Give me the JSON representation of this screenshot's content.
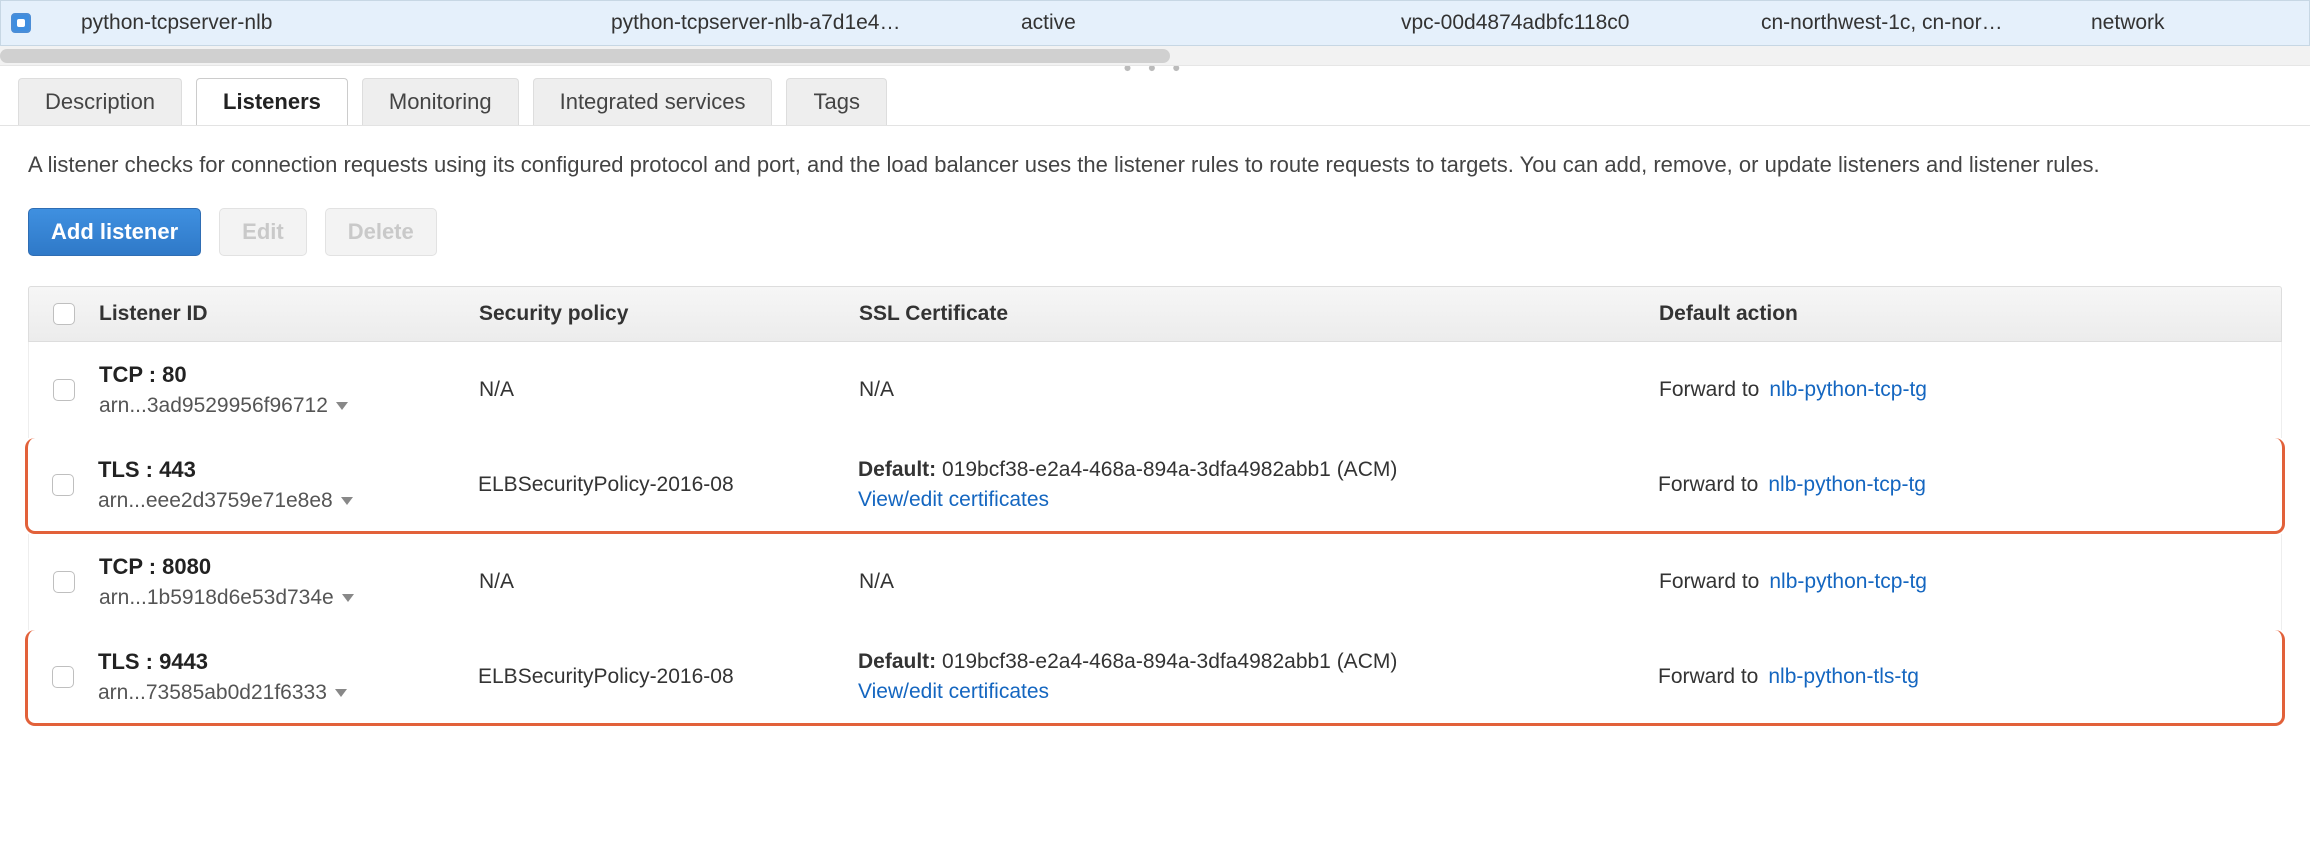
{
  "loadBalancer": {
    "name": "python-tcpserver-nlb",
    "dns": "python-tcpserver-nlb-a7d1e4…",
    "state": "active",
    "vpc": "vpc-00d4874adbfc118c0",
    "az": "cn-northwest-1c, cn-nor…",
    "type": "network"
  },
  "tabs": {
    "description": "Description",
    "listeners": "Listeners",
    "monitoring": "Monitoring",
    "integrated": "Integrated services",
    "tags": "Tags"
  },
  "listenersTab": {
    "description": "A listener checks for connection requests using its configured protocol and port, and the load balancer uses the listener rules to route requests to targets. You can add, remove, or update listeners and listener rules.",
    "buttons": {
      "add": "Add listener",
      "edit": "Edit",
      "delete": "Delete"
    },
    "columns": {
      "listenerId": "Listener ID",
      "securityPolicy": "Security policy",
      "sslCert": "SSL Certificate",
      "defaultAction": "Default action"
    },
    "sslDefaultLabel": "Default:",
    "viewEditLabel": "View/edit certificates",
    "forwardLabel": "Forward to",
    "rows": [
      {
        "protoPort": "TCP : 80",
        "arn": "arn...3ad9529956f96712",
        "securityPolicy": "N/A",
        "sslNA": "N/A",
        "sslDefault": "",
        "hasCert": false,
        "target": "nlb-python-tcp-tg",
        "highlight": false
      },
      {
        "protoPort": "TLS : 443",
        "arn": "arn...eee2d3759e71e8e8",
        "securityPolicy": "ELBSecurityPolicy-2016-08",
        "sslNA": "",
        "sslDefault": "019bcf38-e2a4-468a-894a-3dfa4982abb1 (ACM)",
        "hasCert": true,
        "target": "nlb-python-tcp-tg",
        "highlight": true
      },
      {
        "protoPort": "TCP : 8080",
        "arn": "arn...1b5918d6e53d734e",
        "securityPolicy": "N/A",
        "sslNA": "N/A",
        "sslDefault": "",
        "hasCert": false,
        "target": "nlb-python-tcp-tg",
        "highlight": false
      },
      {
        "protoPort": "TLS : 9443",
        "arn": "arn...73585ab0d21f6333",
        "securityPolicy": "ELBSecurityPolicy-2016-08",
        "sslNA": "",
        "sslDefault": "019bcf38-e2a4-468a-894a-3dfa4982abb1 (ACM)",
        "hasCert": true,
        "target": "nlb-python-tls-tg",
        "highlight": true
      }
    ]
  }
}
